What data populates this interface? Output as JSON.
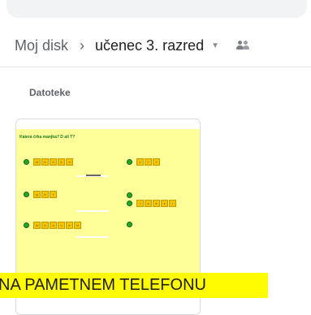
{
  "breadcrumb": {
    "root": "Moj disk",
    "separator": "›",
    "current": "učenec 3. razred"
  },
  "section_label": "Datoteke",
  "file_thumbnail": {
    "title": "Katera črka manjka? D ali T?",
    "words": [
      {
        "letters": [
          "m",
          "e",
          "d",
          "e",
          "d"
        ]
      },
      {
        "letters": [
          "g",
          "e",
          "t"
        ]
      },
      {
        "letters": [
          "m",
          "e",
          "d",
          "v",
          "e",
          "d"
        ]
      },
      {
        "letters": [
          "s",
          "i",
          "t"
        ]
      },
      {
        "letters": [
          "t",
          "a",
          "k",
          "s",
          "i"
        ]
      }
    ]
  },
  "banner_text": "NA PAMETNEM TELEFONU",
  "colors": {
    "thumbnail_bg": "#ffff99",
    "banner_bg": "#fffb00",
    "tile": "#f5c400",
    "accent_green": "#22aa22"
  }
}
